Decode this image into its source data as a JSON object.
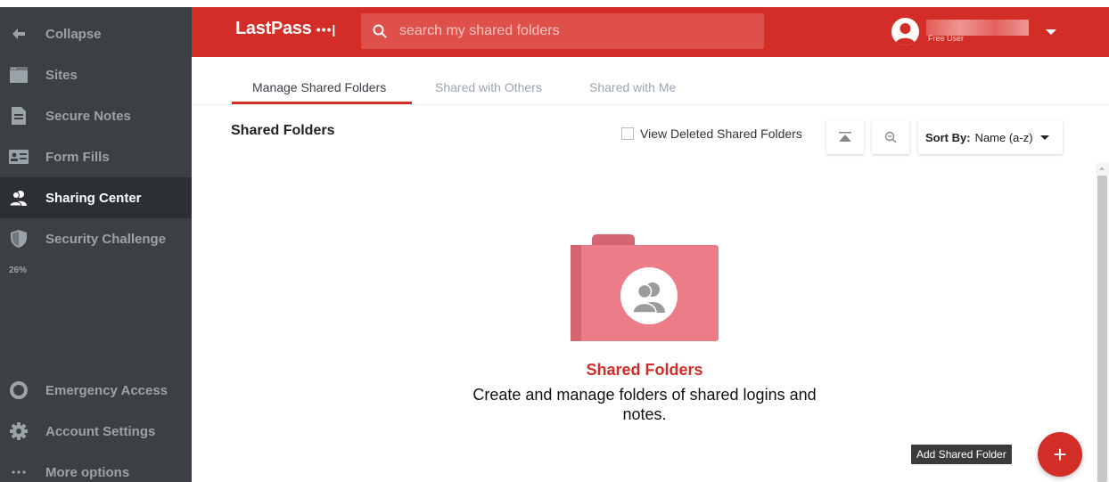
{
  "sidebar": {
    "items": [
      {
        "label": "Collapse",
        "icon": "arrow-left-icon"
      },
      {
        "label": "Sites",
        "icon": "browser-window-icon"
      },
      {
        "label": "Secure Notes",
        "icon": "note-icon"
      },
      {
        "label": "Form Fills",
        "icon": "id-card-icon"
      },
      {
        "label": "Sharing Center",
        "icon": "shared-users-icon"
      },
      {
        "label": "Security Challenge",
        "icon": "shield-icon"
      },
      {
        "label": "Emergency Access",
        "icon": "lifebuoy-icon"
      },
      {
        "label": "Account Settings",
        "icon": "gear-icon"
      },
      {
        "label": "More options",
        "icon": "dots-icon"
      }
    ],
    "active": "Sharing Center",
    "security_score": "26%"
  },
  "header": {
    "logo_text": "LastPass",
    "logo_suffix": "•••|",
    "search_placeholder": "search my shared folders",
    "user_plan": "Free User",
    "accent_color": "#d32d27"
  },
  "tabs": [
    {
      "label": "Manage Shared Folders",
      "active": true
    },
    {
      "label": "Shared with Others",
      "active": false
    },
    {
      "label": "Shared with Me",
      "active": false
    }
  ],
  "toolbar": {
    "title": "Shared Folders",
    "view_deleted_label": "View Deleted Shared Folders",
    "view_deleted_checked": false,
    "sort_label": "Sort By:",
    "sort_value": "Name (a-z)"
  },
  "empty_state": {
    "title": "Shared Folders",
    "description": "Create and manage folders of shared logins and notes."
  },
  "fab": {
    "tooltip": "Add Shared Folder",
    "symbol": "+"
  }
}
